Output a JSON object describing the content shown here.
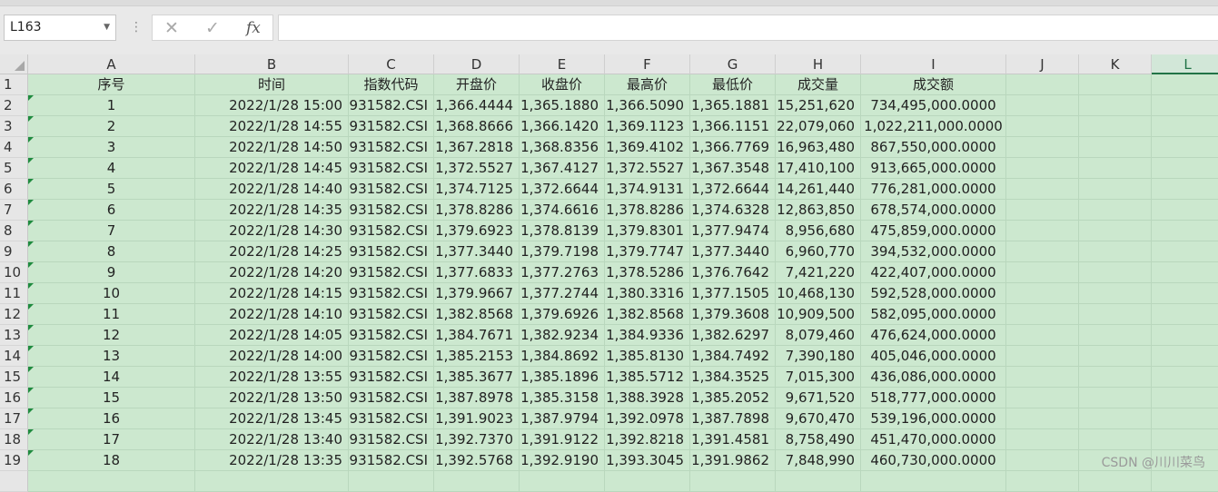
{
  "formula_bar": {
    "name_box": "L163",
    "cancel_icon": "✕",
    "confirm_icon": "✓",
    "fx_label": "fx",
    "formula": ""
  },
  "columns": [
    "A",
    "B",
    "C",
    "D",
    "E",
    "F",
    "G",
    "H",
    "I",
    "J",
    "K",
    "L"
  ],
  "selected_column": "L",
  "header_row": [
    "序号",
    "时间",
    "指数代码",
    "开盘价",
    "收盘价",
    "最高价",
    "最低价",
    "成交量",
    "成交额"
  ],
  "row_numbers": [
    "1",
    "2",
    "3",
    "4",
    "5",
    "6",
    "7",
    "8",
    "9",
    "10",
    "11",
    "12",
    "13",
    "14",
    "15",
    "16",
    "17",
    "18",
    "19"
  ],
  "rows": [
    [
      "1",
      "2022/1/28 15:00",
      "931582.CSI",
      "1,366.4444",
      "1,365.1880",
      "1,366.5090",
      "1,365.1881",
      "15,251,620",
      "734,495,000.0000"
    ],
    [
      "2",
      "2022/1/28 14:55",
      "931582.CSI",
      "1,368.8666",
      "1,366.1420",
      "1,369.1123",
      "1,366.1151",
      "22,079,060",
      "1,022,211,000.0000"
    ],
    [
      "3",
      "2022/1/28 14:50",
      "931582.CSI",
      "1,367.2818",
      "1,368.8356",
      "1,369.4102",
      "1,366.7769",
      "16,963,480",
      "867,550,000.0000"
    ],
    [
      "4",
      "2022/1/28 14:45",
      "931582.CSI",
      "1,372.5527",
      "1,367.4127",
      "1,372.5527",
      "1,367.3548",
      "17,410,100",
      "913,665,000.0000"
    ],
    [
      "5",
      "2022/1/28 14:40",
      "931582.CSI",
      "1,374.7125",
      "1,372.6644",
      "1,374.9131",
      "1,372.6644",
      "14,261,440",
      "776,281,000.0000"
    ],
    [
      "6",
      "2022/1/28 14:35",
      "931582.CSI",
      "1,378.8286",
      "1,374.6616",
      "1,378.8286",
      "1,374.6328",
      "12,863,850",
      "678,574,000.0000"
    ],
    [
      "7",
      "2022/1/28 14:30",
      "931582.CSI",
      "1,379.6923",
      "1,378.8139",
      "1,379.8301",
      "1,377.9474",
      "8,956,680",
      "475,859,000.0000"
    ],
    [
      "8",
      "2022/1/28 14:25",
      "931582.CSI",
      "1,377.3440",
      "1,379.7198",
      "1,379.7747",
      "1,377.3440",
      "6,960,770",
      "394,532,000.0000"
    ],
    [
      "9",
      "2022/1/28 14:20",
      "931582.CSI",
      "1,377.6833",
      "1,377.2763",
      "1,378.5286",
      "1,376.7642",
      "7,421,220",
      "422,407,000.0000"
    ],
    [
      "10",
      "2022/1/28 14:15",
      "931582.CSI",
      "1,379.9667",
      "1,377.2744",
      "1,380.3316",
      "1,377.1505",
      "10,468,130",
      "592,528,000.0000"
    ],
    [
      "11",
      "2022/1/28 14:10",
      "931582.CSI",
      "1,382.8568",
      "1,379.6926",
      "1,382.8568",
      "1,379.3608",
      "10,909,500",
      "582,095,000.0000"
    ],
    [
      "12",
      "2022/1/28 14:05",
      "931582.CSI",
      "1,384.7671",
      "1,382.9234",
      "1,384.9336",
      "1,382.6297",
      "8,079,460",
      "476,624,000.0000"
    ],
    [
      "13",
      "2022/1/28 14:00",
      "931582.CSI",
      "1,385.2153",
      "1,384.8692",
      "1,385.8130",
      "1,384.7492",
      "7,390,180",
      "405,046,000.0000"
    ],
    [
      "14",
      "2022/1/28 13:55",
      "931582.CSI",
      "1,385.3677",
      "1,385.1896",
      "1,385.5712",
      "1,384.3525",
      "7,015,300",
      "436,086,000.0000"
    ],
    [
      "15",
      "2022/1/28 13:50",
      "931582.CSI",
      "1,387.8978",
      "1,385.3158",
      "1,388.3928",
      "1,385.2052",
      "9,671,520",
      "518,777,000.0000"
    ],
    [
      "16",
      "2022/1/28 13:45",
      "931582.CSI",
      "1,391.9023",
      "1,387.9794",
      "1,392.0978",
      "1,387.7898",
      "9,670,470",
      "539,196,000.0000"
    ],
    [
      "17",
      "2022/1/28 13:40",
      "931582.CSI",
      "1,392.7370",
      "1,391.9122",
      "1,392.8218",
      "1,391.4581",
      "8,758,490",
      "451,470,000.0000"
    ],
    [
      "18",
      "2022/1/28 13:35",
      "931582.CSI",
      "1,392.5768",
      "1,392.9190",
      "1,393.3045",
      "1,391.9862",
      "7,848,990",
      "460,730,000.0000"
    ]
  ],
  "watermark": "CSDN @川川菜鸟"
}
